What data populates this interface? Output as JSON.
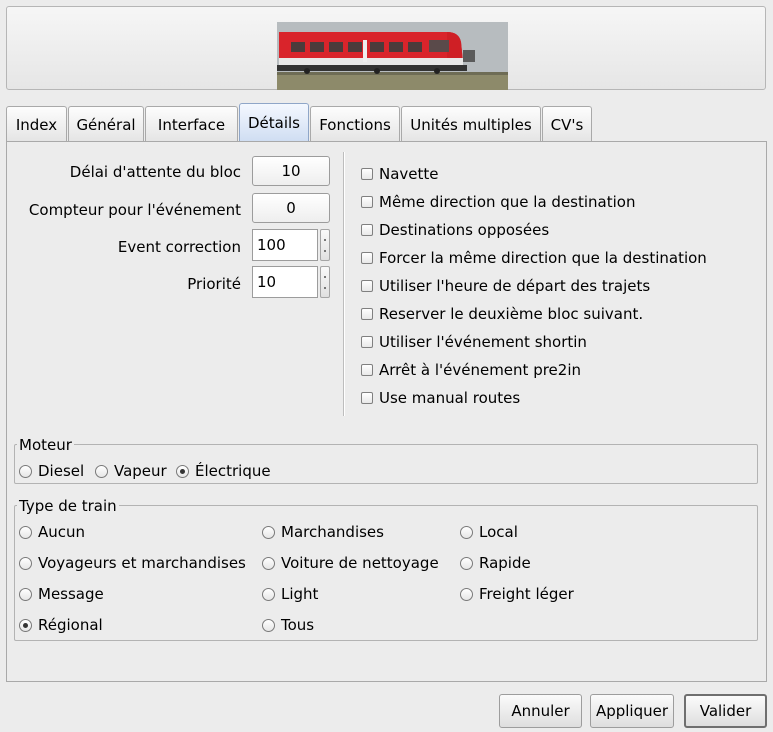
{
  "tabs": [
    {
      "label": "Index"
    },
    {
      "label": "Général"
    },
    {
      "label": "Interface"
    },
    {
      "label": "Détails"
    },
    {
      "label": "Fonctions"
    },
    {
      "label": "Unités multiples"
    },
    {
      "label": "CV's"
    }
  ],
  "active_tab": "Détails",
  "fields": {
    "block_wait_label": "Délai d'attente du bloc",
    "block_wait_value": "10",
    "event_counter_label": "Compteur pour l'événement",
    "event_counter_value": "0",
    "event_correction_label": "Event correction",
    "event_correction_value": "100",
    "priority_label": "Priorité",
    "priority_value": "10"
  },
  "options": [
    {
      "label": "Navette",
      "checked": false
    },
    {
      "label": "Même direction que la destination",
      "checked": false
    },
    {
      "label": "Destinations opposées",
      "checked": false
    },
    {
      "label": "Forcer la même direction que la destination",
      "checked": false
    },
    {
      "label": "Utiliser l'heure de départ des trajets",
      "checked": false
    },
    {
      "label": "Reserver le deuxième bloc suivant.",
      "checked": false
    },
    {
      "label": "Utiliser l'événement shortin",
      "checked": false
    },
    {
      "label": "Arrêt à l'événement pre2in",
      "checked": false
    },
    {
      "label": "Use manual routes",
      "checked": false
    }
  ],
  "engine": {
    "title": "Moteur",
    "choices": [
      "Diesel",
      "Vapeur",
      "Électrique"
    ],
    "selected": "Électrique"
  },
  "train_type": {
    "title": "Type de train",
    "choices": [
      "Aucun",
      "Marchandises",
      "Local",
      "Voyageurs et marchandises",
      "Voiture de nettoyage",
      "Rapide",
      "Message",
      "Light",
      "Freight léger",
      "Régional",
      "Tous"
    ],
    "selected": "Régional"
  },
  "buttons": {
    "cancel": "Annuler",
    "apply": "Appliquer",
    "ok": "Valider"
  },
  "colors": {
    "train_body": "#d9242b",
    "active_tab": "#cfddf2"
  }
}
